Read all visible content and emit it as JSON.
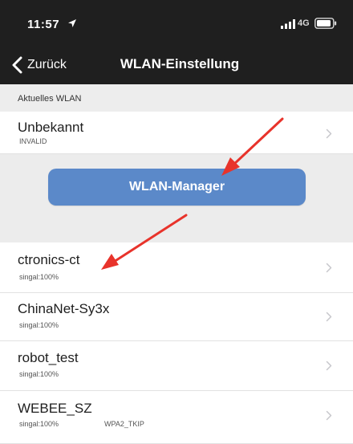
{
  "status_bar": {
    "time": "11:57",
    "network_type": "4G"
  },
  "nav": {
    "back_label": "Zurück",
    "title": "WLAN-Einstellung"
  },
  "current_wlan": {
    "section_label": "Aktuelles WLAN",
    "ssid": "Unbekannt",
    "subtitle": "INVALID"
  },
  "manager_button_label": "WLAN-Manager",
  "networks": [
    {
      "ssid": "ctronics-ct",
      "signal": "singal:100%",
      "security": ""
    },
    {
      "ssid": "ChinaNet-Sy3x",
      "signal": "singal:100%",
      "security": ""
    },
    {
      "ssid": "robot_test",
      "signal": "singal:100%",
      "security": ""
    },
    {
      "ssid": "WEBEE_SZ",
      "signal": "singal:100%",
      "security": "WPA2_TKIP"
    }
  ],
  "colors": {
    "header_bg": "#1f1f1f",
    "accent_button": "#5b89c9",
    "annotation_arrow": "#e8332b"
  },
  "icons": {
    "back": "chevron-left-icon",
    "row_disclosure": "chevron-right-icon",
    "location": "location-arrow-icon",
    "signal": "cellular-signal-icon",
    "battery": "battery-icon"
  }
}
